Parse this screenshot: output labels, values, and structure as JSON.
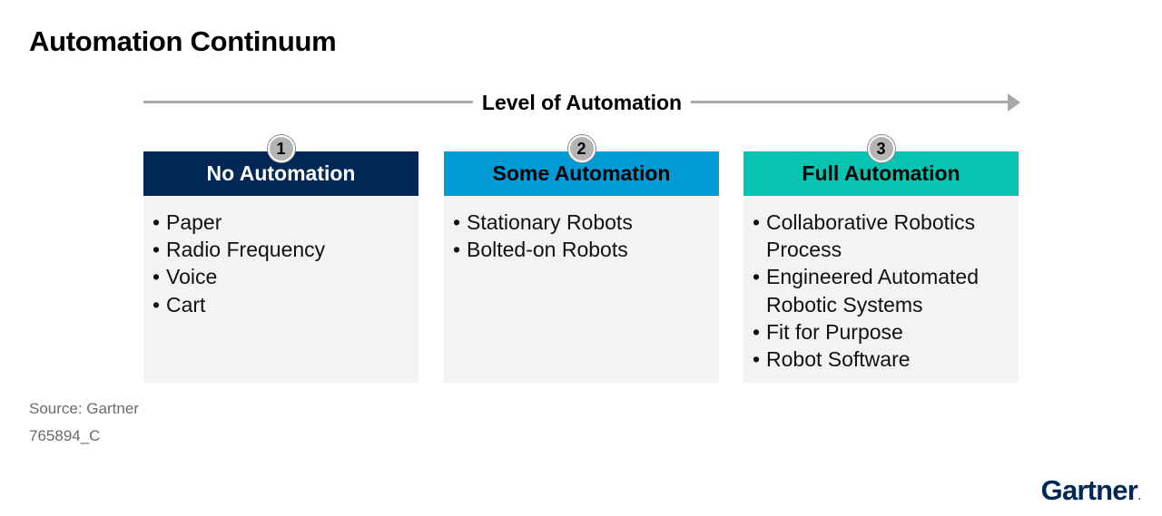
{
  "title": "Automation Continuum",
  "arrow": {
    "label": "Level of Automation",
    "color": "#a9a9a9"
  },
  "columns": [
    {
      "number": "1",
      "header": "No Automation",
      "header_color": "#002856",
      "items": [
        "Paper",
        "Radio Frequency",
        "Voice",
        "Cart"
      ]
    },
    {
      "number": "2",
      "header": "Some Automation",
      "header_color": "#009ad7",
      "items": [
        "Stationary Robots",
        "Bolted-on Robots"
      ]
    },
    {
      "number": "3",
      "header": "Full Automation",
      "header_color": "#06c3b2",
      "items": [
        "Collaborative Robotics Process",
        "Engineered Automated Robotic Systems",
        "Fit for Purpose",
        "Robot Software"
      ]
    }
  ],
  "footer": {
    "source": "Source: Gartner",
    "code": "765894_C"
  },
  "logo": {
    "text": "Gartner",
    "color": "#002856"
  }
}
